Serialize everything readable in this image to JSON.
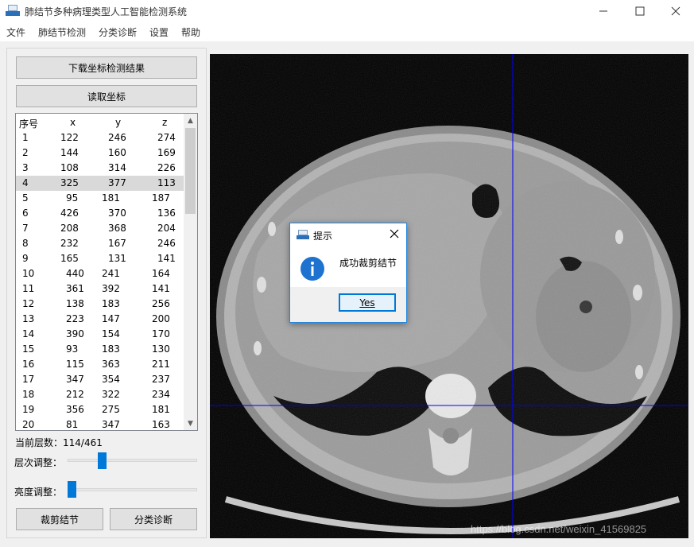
{
  "window": {
    "title": "肺结节多种病理类型人工智能检测系统",
    "min_icon": "minimize-icon",
    "max_icon": "maximize-icon",
    "close_icon": "close-icon"
  },
  "menu": [
    "文件",
    "肺结节检测",
    "分类诊断",
    "设置",
    "帮助"
  ],
  "left": {
    "download_button": "下载坐标检测结果",
    "read_button": "读取坐标",
    "table": {
      "headers": [
        "序号",
        "x",
        "y",
        "z"
      ],
      "selected_row": 4,
      "rows": [
        [
          "1",
          "122",
          "246",
          "274"
        ],
        [
          "2",
          "144",
          "160",
          "169"
        ],
        [
          "3",
          "108",
          "314",
          "226"
        ],
        [
          "4",
          "325",
          "377",
          "113"
        ],
        [
          "5",
          "95",
          "181",
          "187"
        ],
        [
          "6",
          "426",
          "370",
          "136"
        ],
        [
          "7",
          "208",
          "368",
          "204"
        ],
        [
          "8",
          "232",
          "167",
          "246"
        ],
        [
          "9",
          "165",
          "131",
          "141"
        ],
        [
          "10",
          "440",
          "241",
          "164"
        ],
        [
          "11",
          "361",
          "392",
          "141"
        ],
        [
          "12",
          "138",
          "183",
          "256"
        ],
        [
          "13",
          "223",
          "147",
          "200"
        ],
        [
          "14",
          "390",
          "154",
          "170"
        ],
        [
          "15",
          "93",
          "183",
          "130"
        ],
        [
          "16",
          "115",
          "363",
          "211"
        ],
        [
          "17",
          "347",
          "354",
          "237"
        ],
        [
          "18",
          "212",
          "322",
          "234"
        ],
        [
          "19",
          "356",
          "275",
          "181"
        ],
        [
          "20",
          "81",
          "347",
          "163"
        ]
      ]
    },
    "current_layer_label": "当前层数：114/461",
    "layer_adjust_label": "层次调整：",
    "layer_slider_value": 114,
    "layer_slider_max": 461,
    "brightness_label": "亮度调整：",
    "brightness_value": 0.0,
    "crop_button": "裁剪结节",
    "classify_button": "分类诊断"
  },
  "dialog": {
    "title": "提示",
    "message": "成功裁剪结节",
    "yes_button": "Yes",
    "info_icon": "info-icon",
    "close_icon": "close-icon"
  },
  "viewer": {
    "crosshair_color": "#0000ff",
    "watermark": "https://blog.csdn.net/weixin_41569825"
  }
}
